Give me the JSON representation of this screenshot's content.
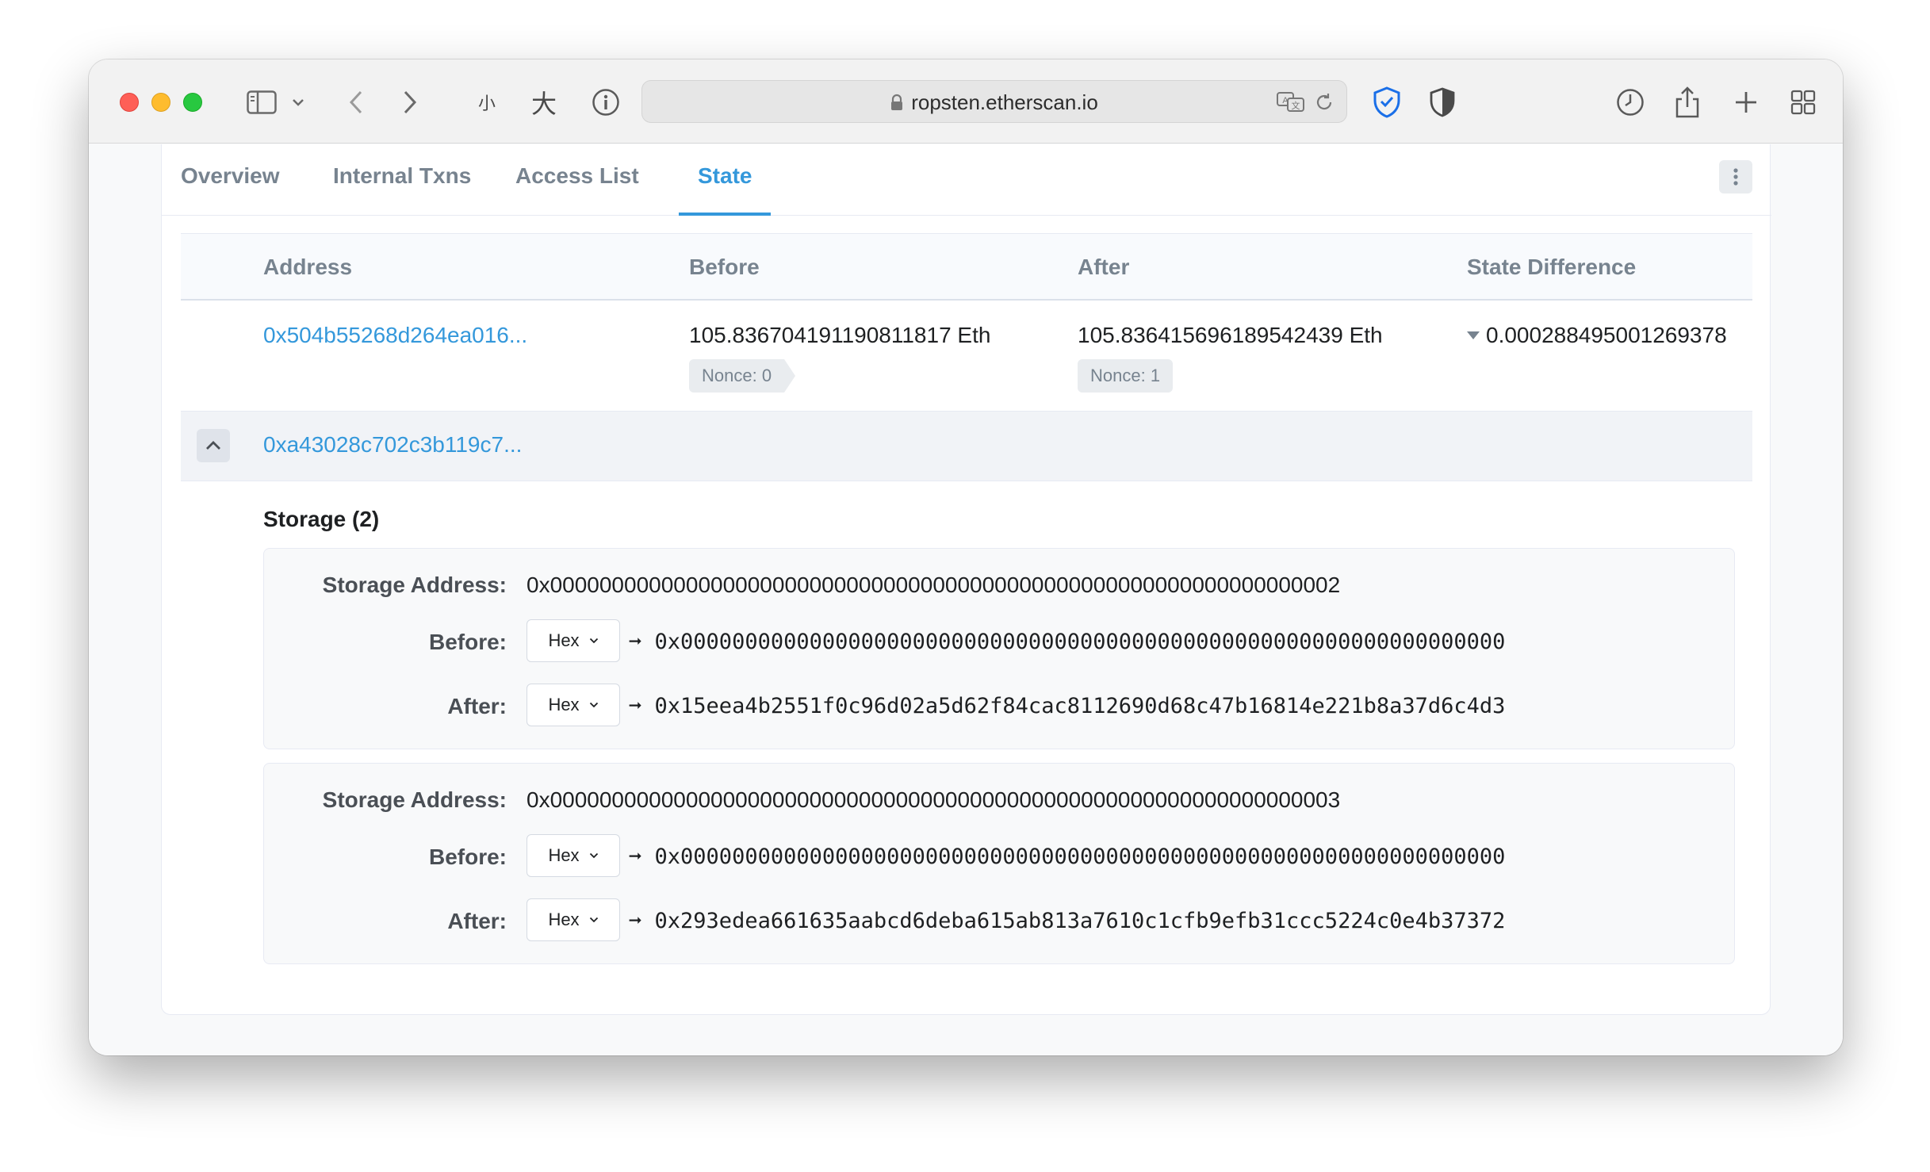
{
  "browser": {
    "url": "ropsten.etherscan.io",
    "reader_small_label": "小",
    "reader_large_label": "大"
  },
  "tabs": [
    {
      "label": "Overview"
    },
    {
      "label": "Internal Txns"
    },
    {
      "label": "Access List"
    },
    {
      "label": "State",
      "active": true
    }
  ],
  "table": {
    "headers": {
      "address": "Address",
      "before": "Before",
      "after": "After",
      "diff": "State Difference"
    },
    "rows": [
      {
        "address": "0x504b55268d264ea016...",
        "before": "105.836704191190811817 Eth",
        "before_nonce": "Nonce: 0",
        "after": "105.836415696189542439 Eth",
        "after_nonce": "Nonce: 1",
        "diff": "0.000288495001269378",
        "diff_direction": "down"
      },
      {
        "address": "0xa43028c702c3b119c7...",
        "expanded": true
      }
    ]
  },
  "storage": {
    "title": "Storage (2)",
    "address_label": "Storage Address:",
    "before_label": "Before:",
    "after_label": "After:",
    "format_option": "Hex",
    "arrow": "➞",
    "entries": [
      {
        "address": "0x0000000000000000000000000000000000000000000000000000000000000002",
        "before": "0x0000000000000000000000000000000000000000000000000000000000000000",
        "after": "0x15eea4b2551f0c96d02a5d62f84cac8112690d68c47b16814e221b8a37d6c4d3"
      },
      {
        "address": "0x0000000000000000000000000000000000000000000000000000000000000003",
        "before": "0x0000000000000000000000000000000000000000000000000000000000000000",
        "after": "0x293edea661635aabcd6deba615ab813a7610c1cfb9efb31ccc5224c0e4b37372"
      }
    ]
  },
  "colors": {
    "link": "#3498db",
    "active_tab": "#3498db",
    "shield_blue": "#1a6fe8"
  }
}
